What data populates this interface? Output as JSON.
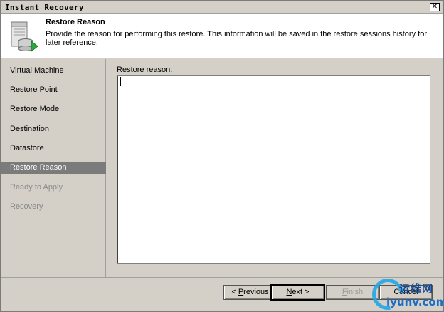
{
  "window": {
    "title": "Instant Recovery",
    "close_glyph": "✕"
  },
  "header": {
    "title": "Restore Reason",
    "description": "Provide the reason for performing this restore. This information will be saved in the restore sessions history for later reference.",
    "icon": "server-database-arrow-icon"
  },
  "sidebar": {
    "items": [
      {
        "label": "Virtual Machine",
        "state": "normal"
      },
      {
        "label": "Restore Point",
        "state": "normal"
      },
      {
        "label": "Restore Mode",
        "state": "normal"
      },
      {
        "label": "Destination",
        "state": "normal"
      },
      {
        "label": "Datastore",
        "state": "normal"
      },
      {
        "label": "Restore Reason",
        "state": "active"
      },
      {
        "label": "Ready to Apply",
        "state": "disabled"
      },
      {
        "label": "Recovery",
        "state": "disabled"
      }
    ]
  },
  "main": {
    "label_mnemonic": "R",
    "label_rest": "estore reason:",
    "reason_value": ""
  },
  "footer": {
    "previous_mnemonic": "P",
    "previous_prefix": "< ",
    "previous_rest": "revious",
    "next_mnemonic": "N",
    "next_rest": "ext >",
    "finish_mnemonic": "F",
    "finish_rest": "inish",
    "cancel_label": "Cancel"
  },
  "watermark": {
    "line1": "运维网",
    "line2": "iyunv.com"
  },
  "colors": {
    "active_item_bg": "#7b7b7b",
    "dialog_bg": "#d4d0c8",
    "disabled_text": "#8a8a8a"
  }
}
